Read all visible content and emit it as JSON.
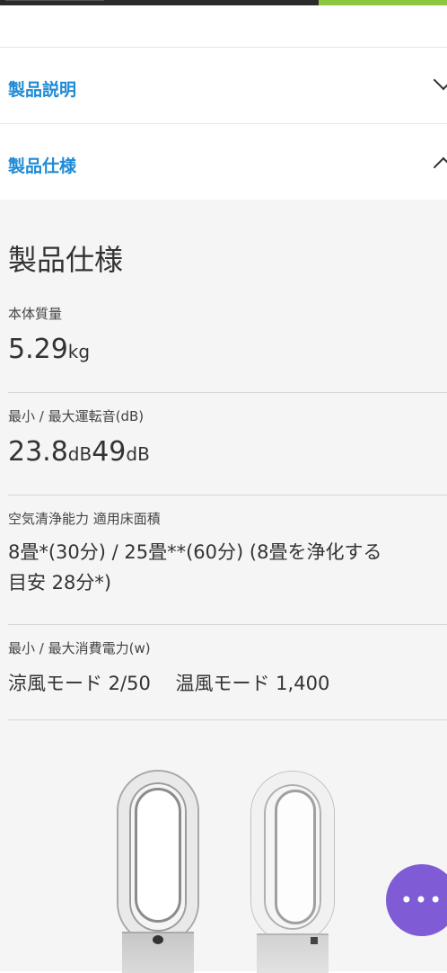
{
  "accordion": [
    {
      "label": "製品説明",
      "state": "collapsed"
    },
    {
      "label": "製品仕様",
      "state": "expanded"
    }
  ],
  "spec": {
    "title": "製品仕様",
    "weight": {
      "label": "本体質量",
      "value": "5.29",
      "unit": "kg"
    },
    "noise": {
      "label": "最小 / 最大運転音(dB)",
      "min": "23.8",
      "min_unit": "dB",
      "max": "49",
      "max_unit": "dB"
    },
    "purify": {
      "label": "空気清浄能力 適用床面積",
      "line1": "8畳*(30分) / 25畳**(60分) (8畳を浄化する",
      "line2": "目安 28分*)"
    },
    "power": {
      "label": "最小 / 最大消費電力(w)",
      "value": "涼風モード 2/50　 温風モード 1,400"
    }
  },
  "chat": {
    "label": "•••",
    "icon": "more-icon",
    "color": "#7f5bd6"
  },
  "colors": {
    "accent": "#1e8bd6",
    "green": "#8dc63f"
  }
}
